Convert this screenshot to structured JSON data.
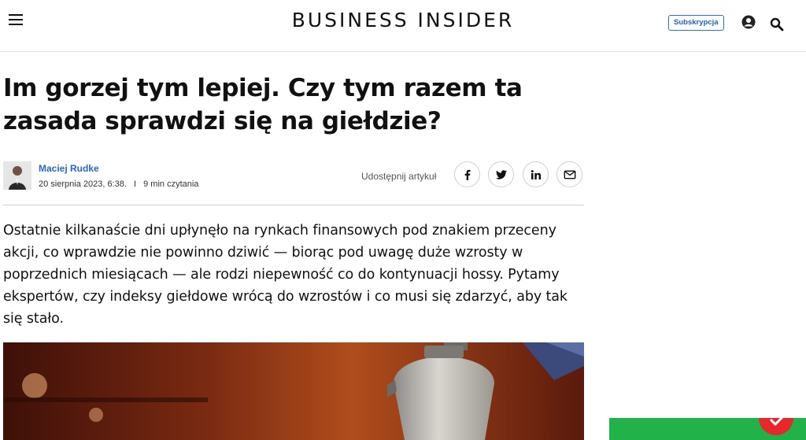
{
  "header": {
    "brand": "BUSINESS INSIDER",
    "subscribe_label": "Subskrypcja",
    "menu_icon": "hamburger-icon",
    "user_icon": "user-icon",
    "search_icon": "search-icon"
  },
  "article": {
    "title": "Im gorzej tym lepiej. Czy tym razem ta zasada sprawdzi się na giełdzie?",
    "author": "Maciej Rudke",
    "date": "20 sierpnia 2023, 6:38.",
    "separator": "I",
    "read_time": "9 min czytania",
    "share_label": "Udostępnij artykuł",
    "share_buttons": [
      "facebook-icon",
      "twitter-icon",
      "linkedin-icon",
      "mail-icon"
    ],
    "lead": "Ostatnie kilkanaście dni upłynęło na rynkach finansowych pod znakiem przeceny akcji, co wprawdzie nie powinno dziwić — biorąc pod uwagę duże wzrosty w poprzednich miesiącach — ale rodzi niepewność co do kontynuacji hossy. Pytamy ekspertów, czy indeksy giełdowe wrócą do wzrostów i co musi się zdarzyć, aby tak się stało."
  },
  "colors": {
    "accent": "#2b67c9",
    "subscribe_border": "#2a6fd6",
    "ad_green": "#21b34a",
    "hero_bg": "#5a1e0f"
  }
}
